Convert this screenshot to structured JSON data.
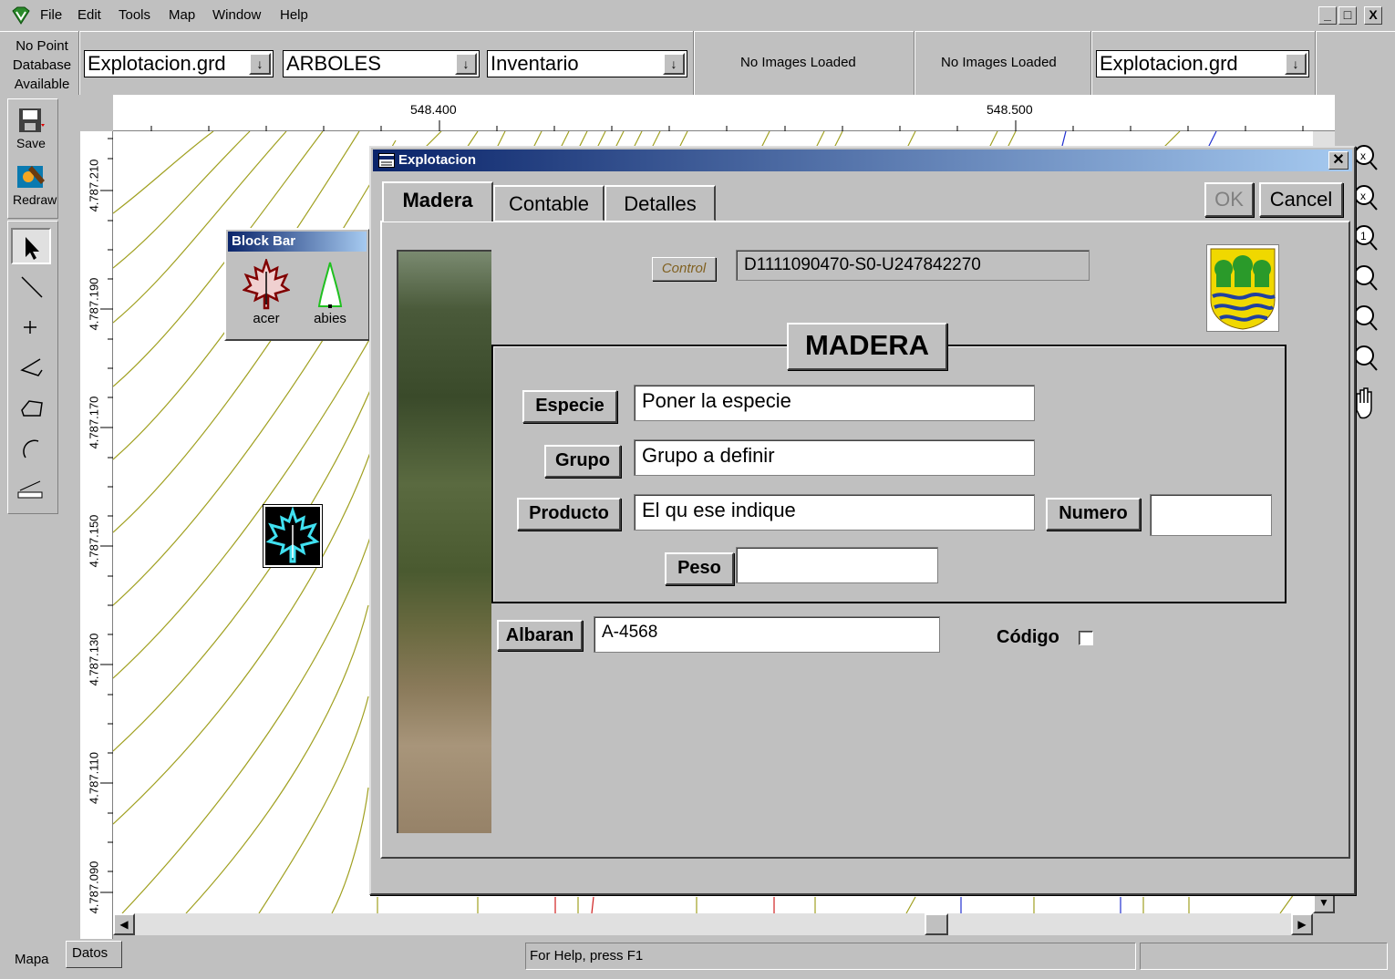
{
  "menubar": {
    "items": [
      "File",
      "Edit",
      "Tools",
      "Map",
      "Window",
      "Help"
    ],
    "window_controls": [
      "_",
      "□",
      "X"
    ]
  },
  "toolbar": {
    "no_point_db": "No Point Database Available",
    "combo_grid": "Explotacion.grd",
    "combo_layer": "ARBOLES",
    "combo_table": "Inventario",
    "images1": "No Images Loaded",
    "images2": "No Images Loaded",
    "combo_grid2": "Explotacion.grd"
  },
  "left_tools": {
    "save": "Save",
    "redraw": "Redraw"
  },
  "rulers": {
    "x_labels": [
      "548.400",
      "548.500"
    ],
    "y_labels": [
      "4.787.210",
      "4.787.190",
      "4.787.170",
      "4.787.150",
      "4.787.130",
      "4.787.110",
      "4.787.090"
    ]
  },
  "block_bar": {
    "title": "Block Bar",
    "items": [
      "acer",
      "abies"
    ]
  },
  "dialog": {
    "title": "Explotacion",
    "tabs": [
      "Madera",
      "Contable",
      "Detalles"
    ],
    "ok": "OK",
    "cancel": "Cancel",
    "control_label": "Control",
    "control_value": "D1111090470-S0-U247842270",
    "section_title": "MADERA",
    "especie_label": "Especie",
    "especie_value": "Poner la especie",
    "grupo_label": "Grupo",
    "grupo_value": "Grupo a definir",
    "producto_label": "Producto",
    "producto_value": "El qu ese indique",
    "numero_label": "Numero",
    "numero_value": "",
    "peso_label": "Peso",
    "peso_value": "",
    "albaran_label": "Albaran",
    "albaran_value": "A-4568",
    "codigo_label": "Código",
    "codigo_checked": false
  },
  "statusbar": {
    "tab_mapa": "Mapa",
    "tab_datos": "Datos",
    "help": "For Help, press F1"
  }
}
